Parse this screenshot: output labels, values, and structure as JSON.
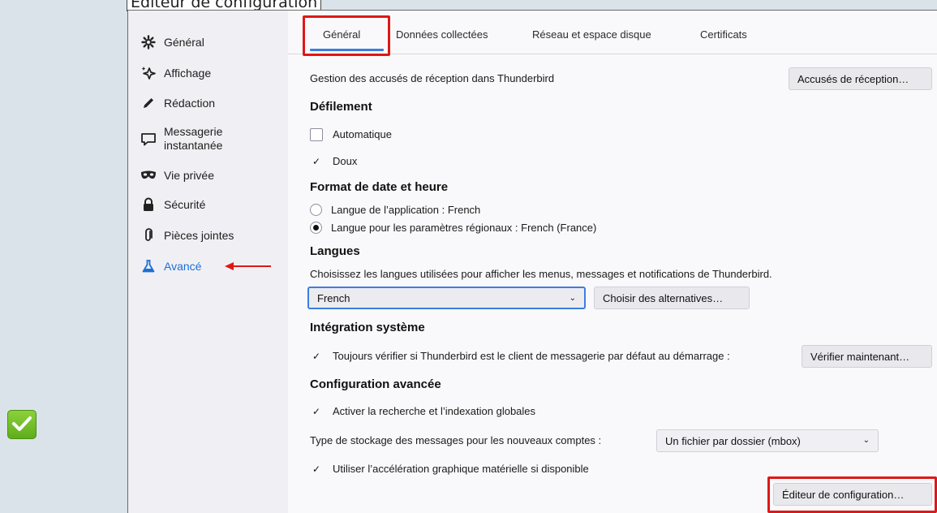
{
  "window": {
    "banner_title": "Éditeur de configuration"
  },
  "sidebar": {
    "items": [
      {
        "label": "Général",
        "icon": "gear-icon"
      },
      {
        "label": "Affichage",
        "icon": "sparkle-icon"
      },
      {
        "label": "Rédaction",
        "icon": "pen-icon"
      },
      {
        "label_line1": "Messagerie",
        "label_line2": "instantanée",
        "icon": "chat-icon"
      },
      {
        "label": "Vie privée",
        "icon": "mask-icon"
      },
      {
        "label": "Sécurité",
        "icon": "lock-icon"
      },
      {
        "label": "Pièces jointes",
        "icon": "paperclip-icon"
      },
      {
        "label": "Avancé",
        "icon": "flask-icon"
      }
    ]
  },
  "tabs": [
    {
      "label": "Général"
    },
    {
      "label": "Données collectées"
    },
    {
      "label": "Réseau et espace disque"
    },
    {
      "label": "Certificats"
    }
  ],
  "receipts": {
    "text": "Gestion des accusés de réception dans Thunderbird",
    "button": "Accusés de réception…"
  },
  "scrolling": {
    "heading": "Défilement",
    "automatic": {
      "label": "Automatique",
      "checked": false
    },
    "smooth": {
      "label": "Doux",
      "checked": true
    }
  },
  "datetime": {
    "heading": "Format de date et heure",
    "app_locale": {
      "label": "Langue de l’application : French",
      "selected": false
    },
    "regional": {
      "label": "Langue pour les paramètres régionaux : French (France)",
      "selected": true
    }
  },
  "languages": {
    "heading": "Langues",
    "description": "Choisissez les langues utilisées pour afficher les menus, messages et notifications de Thunderbird.",
    "selected": "French",
    "alternatives_button": "Choisir des alternatives…"
  },
  "integration": {
    "heading": "Intégration système",
    "default_check": {
      "label": "Toujours vérifier si Thunderbird est le client de messagerie par défaut au démarrage :",
      "checked": true
    },
    "check_now_button": "Vérifier maintenant…"
  },
  "advanced": {
    "heading": "Configuration avancée",
    "global_search": {
      "label": "Activer la recherche et l’indexation globales",
      "checked": true
    },
    "storage_label": "Type de stockage des messages pour les nouveaux comptes :",
    "storage_value": "Un fichier par dossier (mbox)",
    "hw_accel": {
      "label": "Utiliser l’accélération graphique matérielle si disponible",
      "checked": true
    },
    "config_editor_button": "Éditeur de configuration…"
  },
  "colors": {
    "accent": "#3b7ee0",
    "highlight": "#e01717",
    "active_nav": "#1b6fd6",
    "success": "#6dbd24"
  },
  "icons": {
    "success_badge": "checkmark-icon",
    "pointer": "red-arrow-icon",
    "dropdown": "chevron-down-icon"
  }
}
